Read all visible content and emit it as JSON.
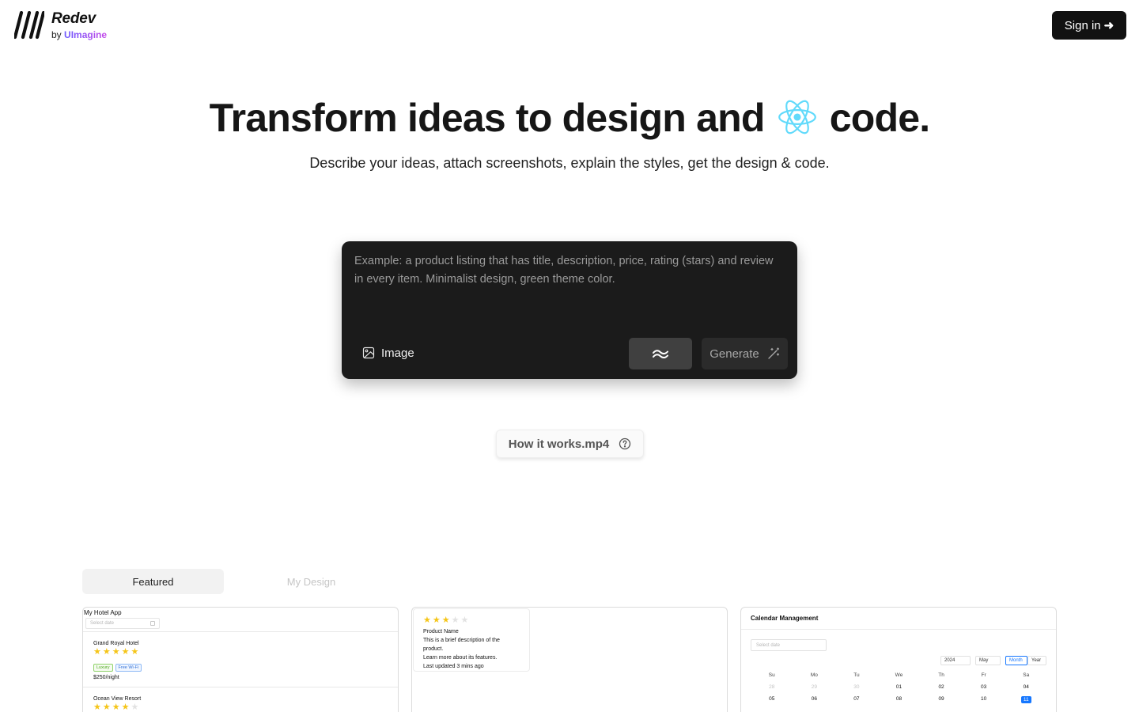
{
  "header": {
    "brand_name": "Redev",
    "brand_by": "by",
    "brand_company": "UImagine",
    "signin_label": "Sign in",
    "signin_arrow": "➜"
  },
  "hero": {
    "title_before": "Transform ideas to design and",
    "title_after": "code.",
    "subtitle": "Describe your ideas, attach screenshots, explain the styles, get the design & code."
  },
  "prompt": {
    "placeholder": "Example: a product listing that has title, description, price, rating (stars) and review in every item. Minimalist design, green theme color.",
    "image_label": "Image",
    "generate_label": "Generate"
  },
  "how_it_works_label": "How it works.mp4",
  "tabs": [
    {
      "label": "Featured",
      "active": true
    },
    {
      "label": "My Design",
      "active": false
    }
  ],
  "cards": {
    "hotel": {
      "title": "My Hotel App",
      "date_placeholder": "Select date",
      "hotels": [
        {
          "name": "Grand Royal Hotel",
          "stars": 5,
          "tags": [
            "Luxury",
            "Free Wi-Fi"
          ],
          "price": "$250/night"
        },
        {
          "name": "Ocean View Resort",
          "stars": 4
        }
      ]
    },
    "product": {
      "stars": 3,
      "name": "Product Name",
      "description_1": "This is a brief description of the product.",
      "description_2": "Learn more about its features.",
      "updated": "Last updated 3 mins ago"
    },
    "calendar": {
      "title": "Calendar Management",
      "date_placeholder": "Select date",
      "year": "2024",
      "month": "May",
      "mode_month": "Month",
      "mode_year": "Year",
      "weekdays": [
        "Su",
        "Mo",
        "Tu",
        "We",
        "Th",
        "Fr",
        "Sa"
      ],
      "week1": [
        "28",
        "29",
        "30",
        "01",
        "02",
        "03",
        "04"
      ],
      "week2": [
        "05",
        "06",
        "07",
        "08",
        "09",
        "10",
        "11"
      ],
      "selected_day": "11"
    }
  },
  "colors": {
    "prompt_bg": "#1b1b1b",
    "brand_gradient_start": "#6d5bff",
    "brand_gradient_end": "#c548e8",
    "react_blue": "#61dafb",
    "star_yellow": "#f5c518",
    "calendar_selected": "#1677ff"
  },
  "icons": {
    "logo": "slashes-logo-icon",
    "react": "react-icon",
    "image": "image-icon",
    "tailwind": "tailwind-icon",
    "generate": "magic-wand-icon",
    "help": "question-circle-icon"
  }
}
